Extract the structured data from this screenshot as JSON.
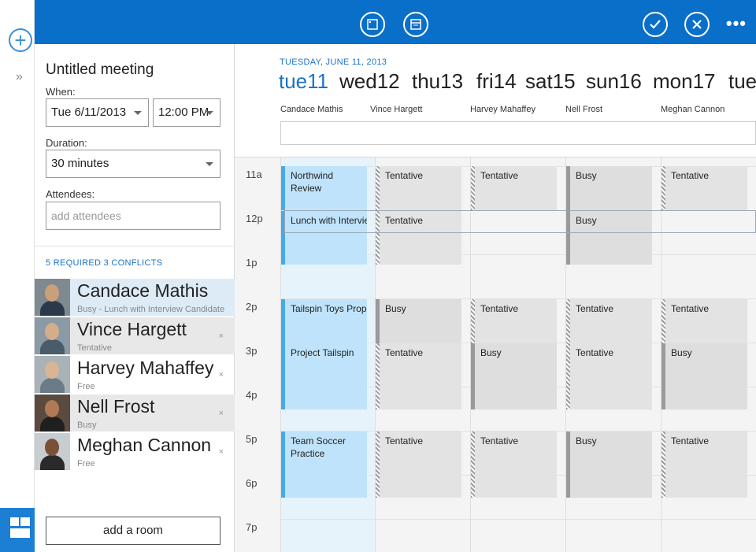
{
  "toolbar": {
    "icons": [
      "window-icon",
      "calendar-view-icon",
      "check-icon",
      "close-icon",
      "more-icon"
    ],
    "more": "•••"
  },
  "rail": {
    "add": "+",
    "expand": "»"
  },
  "meeting": {
    "title": "Untitled meeting",
    "when_label": "When:",
    "date": "Tue 6/11/2013",
    "time": "12:00 PM",
    "duration_label": "Duration:",
    "duration": "30 minutes",
    "attendees_label": "Attendees:",
    "attendees_placeholder": "add attendees",
    "conflicts": "5 REQUIRED 3 CONFLICTS",
    "add_room": "add a room"
  },
  "attendees": [
    {
      "name": "Candace Mathis",
      "status": "Busy - Lunch with Interview Candidate",
      "remove": ""
    },
    {
      "name": "Vince Hargett",
      "status": "Tentative",
      "remove": "×"
    },
    {
      "name": "Harvey Mahaffey",
      "status": "Free",
      "remove": "×"
    },
    {
      "name": "Nell Frost",
      "status": "Busy",
      "remove": "×"
    },
    {
      "name": "Meghan Cannon",
      "status": "Free",
      "remove": "×"
    }
  ],
  "calendar": {
    "date_label": "TUESDAY, JUNE 11, 2013",
    "days": [
      {
        "label": "tue11",
        "active": true
      },
      {
        "label": "wed12"
      },
      {
        "label": "thu13"
      },
      {
        "label": "fri14"
      },
      {
        "label": "sat15"
      },
      {
        "label": "sun16"
      },
      {
        "label": "mon17"
      },
      {
        "label": "tue"
      }
    ],
    "people": [
      "Candace Mathis",
      "Vince Hargett",
      "Harvey Mahaffey",
      "Nell Frost",
      "Meghan Cannon"
    ],
    "hours": [
      "11a",
      "12p",
      "1p",
      "2p",
      "3p",
      "4p",
      "5p",
      "6p",
      "7p"
    ],
    "events": {
      "c0_11": "Northwind Review",
      "c0_12": "Lunch with Interview Candidate",
      "c0_2": "Tailspin Toys Proposal",
      "c0_3": "Project Tailspin",
      "c0_5": "Team Soccer Practice",
      "c1_11": "Tentative",
      "c1_12": "Tentative",
      "c1_2": "Busy",
      "c1_3": "Tentative",
      "c1_5": "Tentative",
      "c2_11": "Tentative",
      "c2_2": "Tentative",
      "c2_3": "Busy",
      "c2_5": "Tentative",
      "c3_11": "Busy",
      "c3_12": "Busy",
      "c3_2": "Tentative",
      "c3_3": "Tentative",
      "c3_5": "Busy",
      "c4_11": "Tentative",
      "c4_2": "Tentative",
      "c4_3": "Busy",
      "c4_5": "Tentative"
    }
  }
}
